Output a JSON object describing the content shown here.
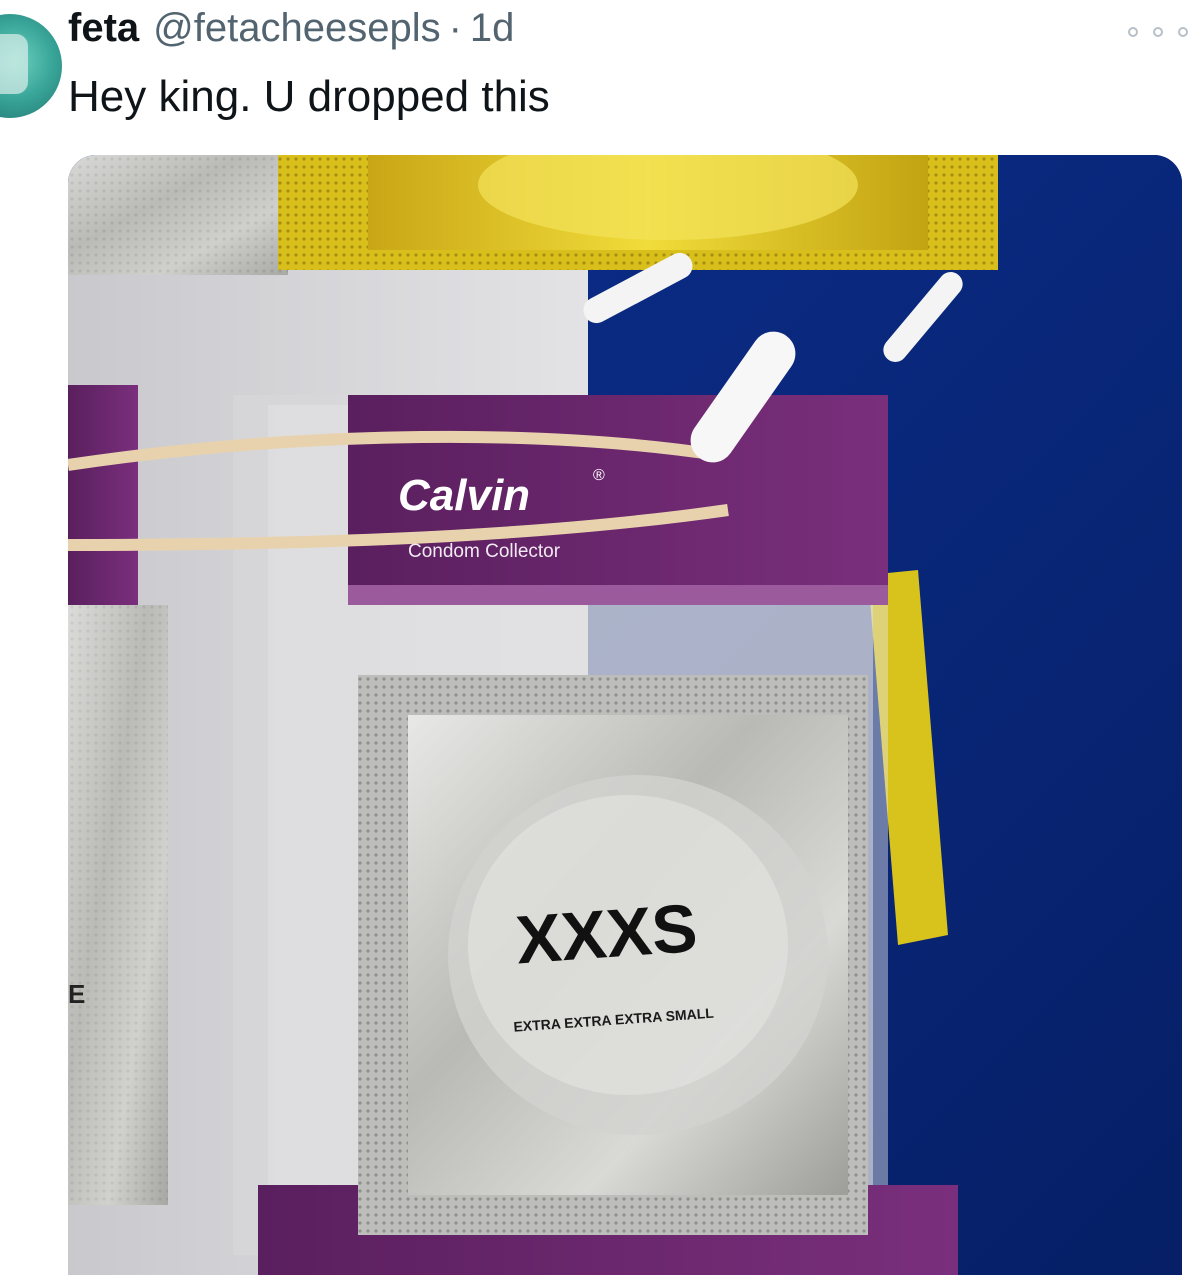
{
  "tweet": {
    "display_name": "feta",
    "handle": "@fetacheesepls",
    "separator": "·",
    "time": "1d",
    "text": "Hey king. U dropped this"
  },
  "media": {
    "packet": {
      "brand": "Calvin",
      "registered": "®",
      "subtitle": "Condom Collector",
      "size_label": "XXXS",
      "size_desc": "EXTRA EXTRA EXTRA SMALL",
      "left_fragment": "E"
    }
  },
  "colors": {
    "name": "#0f1419",
    "secondary": "#536471",
    "background_blue": "#0a2a80",
    "packet_purple": "#6a2a6a",
    "gold_packet": "#d9c21a"
  }
}
